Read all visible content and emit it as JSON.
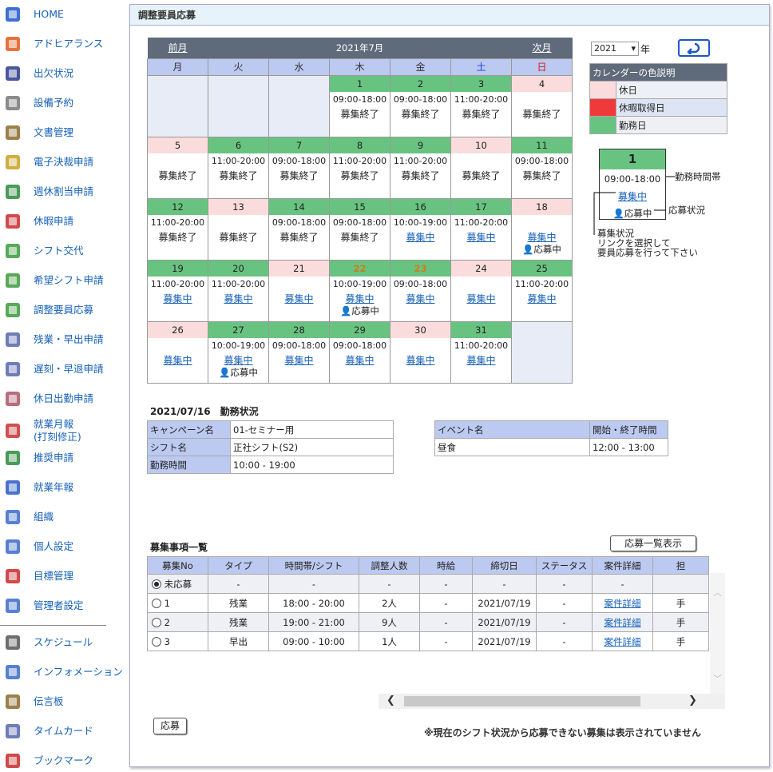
{
  "sidebar": {
    "items": [
      {
        "label": "HOME",
        "icon": "home-icon",
        "color": "#1d56c8"
      },
      {
        "label": "アドヒアランス",
        "icon": "headset-icon",
        "color": "#e05a1a"
      },
      {
        "label": "出欠状況",
        "icon": "chair-icon",
        "color": "#2a3a8c"
      },
      {
        "label": "設備予約",
        "icon": "building-icon",
        "color": "#777"
      },
      {
        "label": "文書管理",
        "icon": "binders-icon",
        "color": "#8a6a2a"
      },
      {
        "label": "電子決裁申請",
        "icon": "coins-icon",
        "color": "#c8a020"
      },
      {
        "label": "週休割当申請",
        "icon": "umbrella-icon",
        "color": "#2a8a3a"
      },
      {
        "label": "休暇申請",
        "icon": "umbrella-red-icon",
        "color": "#c82a2a"
      },
      {
        "label": "シフト交代",
        "icon": "briefcase-icon",
        "color": "#3a9a3a"
      },
      {
        "label": "希望シフト申請",
        "icon": "briefcase-icon",
        "color": "#3a9a3a"
      },
      {
        "label": "調整要員応募",
        "icon": "briefcase-icon",
        "color": "#3a9a3a"
      },
      {
        "label": "残業・早出申請",
        "icon": "form-icon",
        "color": "#5566aa"
      },
      {
        "label": "遅刻・早退申請",
        "icon": "form-icon",
        "color": "#5566aa"
      },
      {
        "label": "休日出勤申請",
        "icon": "form-red-icon",
        "color": "#aa5566"
      },
      {
        "label": "就業月報\n(打刻修正)",
        "icon": "month-icon",
        "color": "#c83030"
      },
      {
        "label": "推奨申請",
        "icon": "month-green-icon",
        "color": "#2a8a3a"
      },
      {
        "label": "就業年報",
        "icon": "year-icon",
        "color": "#2a5ac8"
      },
      {
        "label": "組織",
        "icon": "people-icon",
        "color": "#3a6ac8"
      },
      {
        "label": "個人設定",
        "icon": "person-gear-icon",
        "color": "#3a6ac8"
      },
      {
        "label": "目標管理",
        "icon": "target-icon",
        "color": "#c82a2a"
      },
      {
        "label": "管理者設定",
        "icon": "admin-gear-icon",
        "color": "#3a6ac8"
      },
      {
        "label": "スケジュール",
        "icon": "clock-icon",
        "color": "#555"
      },
      {
        "label": "インフォメーション",
        "icon": "info-icon",
        "color": "#3a6ac8"
      },
      {
        "label": "伝言板",
        "icon": "board-icon",
        "color": "#8a6a2a"
      },
      {
        "label": "タイムカード",
        "icon": "form-icon",
        "color": "#5566aa"
      },
      {
        "label": "ブックマーク",
        "icon": "bookmark-icon",
        "color": "#c82a2a"
      }
    ]
  },
  "panel": {
    "title": "調整要員応募"
  },
  "calendar": {
    "prev": "前月",
    "next": "次月",
    "month": "2021年7月",
    "weekdays": [
      "月",
      "火",
      "水",
      "木",
      "金",
      "土",
      "日"
    ],
    "weeks": [
      [
        null,
        null,
        null,
        {
          "d": "1",
          "t": "work",
          "time": "09:00-18:00",
          "status": "募集終了"
        },
        {
          "d": "2",
          "t": "work",
          "time": "09:00-18:00",
          "status": "募集終了"
        },
        {
          "d": "3",
          "t": "work",
          "time": "11:00-20:00",
          "status": "募集終了"
        },
        {
          "d": "4",
          "t": "off",
          "time": "",
          "status": "募集終了"
        }
      ],
      [
        {
          "d": "5",
          "t": "off",
          "time": "",
          "status": "募集終了"
        },
        {
          "d": "6",
          "t": "work",
          "time": "11:00-20:00",
          "status": "募集終了"
        },
        {
          "d": "7",
          "t": "work",
          "time": "09:00-18:00",
          "status": "募集終了"
        },
        {
          "d": "8",
          "t": "work",
          "time": "11:00-20:00",
          "status": "募集終了"
        },
        {
          "d": "9",
          "t": "work",
          "time": "11:00-20:00",
          "status": "募集終了"
        },
        {
          "d": "10",
          "t": "off",
          "time": "",
          "status": "募集終了"
        },
        {
          "d": "11",
          "t": "work",
          "time": "09:00-18:00",
          "status": "募集終了"
        }
      ],
      [
        {
          "d": "12",
          "t": "work",
          "time": "11:00-20:00",
          "status": "募集終了"
        },
        {
          "d": "13",
          "t": "off",
          "time": "",
          "status": "募集終了"
        },
        {
          "d": "14",
          "t": "work",
          "time": "09:00-18:00",
          "status": "募集終了"
        },
        {
          "d": "15",
          "t": "work",
          "time": "09:00-18:00",
          "status": "募集終了"
        },
        {
          "d": "16",
          "t": "work",
          "time": "10:00-19:00",
          "status": "募集中",
          "link": true
        },
        {
          "d": "17",
          "t": "work",
          "time": "11:00-20:00",
          "status": "募集中",
          "link": true
        },
        {
          "d": "18",
          "t": "off",
          "time": "",
          "status": "募集中",
          "link": true,
          "applied": "応募中"
        }
      ],
      [
        {
          "d": "19",
          "t": "work",
          "time": "11:00-20:00",
          "status": "募集中",
          "link": true
        },
        {
          "d": "20",
          "t": "work",
          "time": "11:00-20:00",
          "status": "募集中",
          "link": true
        },
        {
          "d": "21",
          "t": "off",
          "time": "",
          "status": "募集中",
          "link": true
        },
        {
          "d": "22",
          "t": "hol",
          "time": "10:00-19:00",
          "status": "募集中",
          "link": true,
          "applied": "応募中"
        },
        {
          "d": "23",
          "t": "hol",
          "time": "09:00-18:00",
          "status": "募集中",
          "link": true
        },
        {
          "d": "24",
          "t": "off",
          "time": "",
          "status": "募集中",
          "link": true
        },
        {
          "d": "25",
          "t": "work",
          "time": "11:00-20:00",
          "status": "募集中",
          "link": true
        }
      ],
      [
        {
          "d": "26",
          "t": "off",
          "time": "",
          "status": "募集中",
          "link": true
        },
        {
          "d": "27",
          "t": "work",
          "time": "10:00-19:00",
          "status": "募集中",
          "link": true,
          "applied": "応募中"
        },
        {
          "d": "28",
          "t": "work",
          "time": "09:00-18:00",
          "status": "募集中",
          "link": true
        },
        {
          "d": "29",
          "t": "work",
          "time": "09:00-18:00",
          "status": "募集中",
          "link": true
        },
        {
          "d": "30",
          "t": "off",
          "time": "",
          "status": "募集中",
          "link": true
        },
        {
          "d": "31",
          "t": "work",
          "time": "11:00-20:00",
          "status": "募集中",
          "link": true
        },
        null
      ]
    ]
  },
  "year_select": {
    "value": "2021",
    "suffix": "年"
  },
  "legend": {
    "title": "カレンダーの色説明",
    "items": [
      {
        "color": "#fbdcdc",
        "label": "休日"
      },
      {
        "color": "#f03a3a",
        "label": "休暇取得日"
      },
      {
        "color": "#68c381",
        "label": "勤務日"
      }
    ]
  },
  "sample": {
    "num": "1",
    "time": "09:00-18:00",
    "link": "募集中",
    "applied": "応募中",
    "note_time": "勤務時間帯",
    "note_status": "応募状況",
    "note_bottom": [
      "募集状況",
      "リンクを選択して",
      "要員応募を行って下さい"
    ]
  },
  "work_status": {
    "title": "2021/07/16　勤務状況",
    "rows": [
      {
        "k": "キャンペーン名",
        "v": "01-セミナー用"
      },
      {
        "k": "シフト名",
        "v": "正社シフト(S2)"
      },
      {
        "k": "勤務時間",
        "v": "10:00 - 19:00"
      }
    ],
    "event_head": [
      "イベント名",
      "開始・終了時間"
    ],
    "event_rows": [
      [
        "昼食",
        "12:00 - 13:00"
      ]
    ]
  },
  "recruit": {
    "title": "募集事項一覧",
    "list_button": "応募一覧表示",
    "headers": [
      "募集No",
      "タイプ",
      "時間帯/シフト",
      "調整人数",
      "時給",
      "締切日",
      "ステータス",
      "案件詳細",
      "担"
    ],
    "rows": [
      {
        "no": "未応募",
        "selected": true,
        "type": "-",
        "time": "-",
        "count": "-",
        "wage": "-",
        "deadline": "-",
        "status": "-",
        "detail": "-",
        "extra": ""
      },
      {
        "no": "1",
        "selected": false,
        "type": "残業",
        "time": "18:00 - 20:00",
        "count": "2人",
        "wage": "-",
        "deadline": "2021/07/19",
        "status": "-",
        "detail": "案件詳細",
        "extra": "手"
      },
      {
        "no": "2",
        "selected": false,
        "type": "残業",
        "time": "19:00 - 21:00",
        "count": "9人",
        "wage": "-",
        "deadline": "2021/07/19",
        "status": "-",
        "detail": "案件詳細",
        "extra": "手"
      },
      {
        "no": "3",
        "selected": false,
        "type": "早出",
        "time": "09:00 - 10:00",
        "count": "1人",
        "wage": "-",
        "deadline": "2021/07/19",
        "status": "-",
        "detail": "案件詳細",
        "extra": "手"
      }
    ],
    "apply_button": "応募",
    "note": "※現在のシフト状況から応募できない募集は表示されていません"
  }
}
